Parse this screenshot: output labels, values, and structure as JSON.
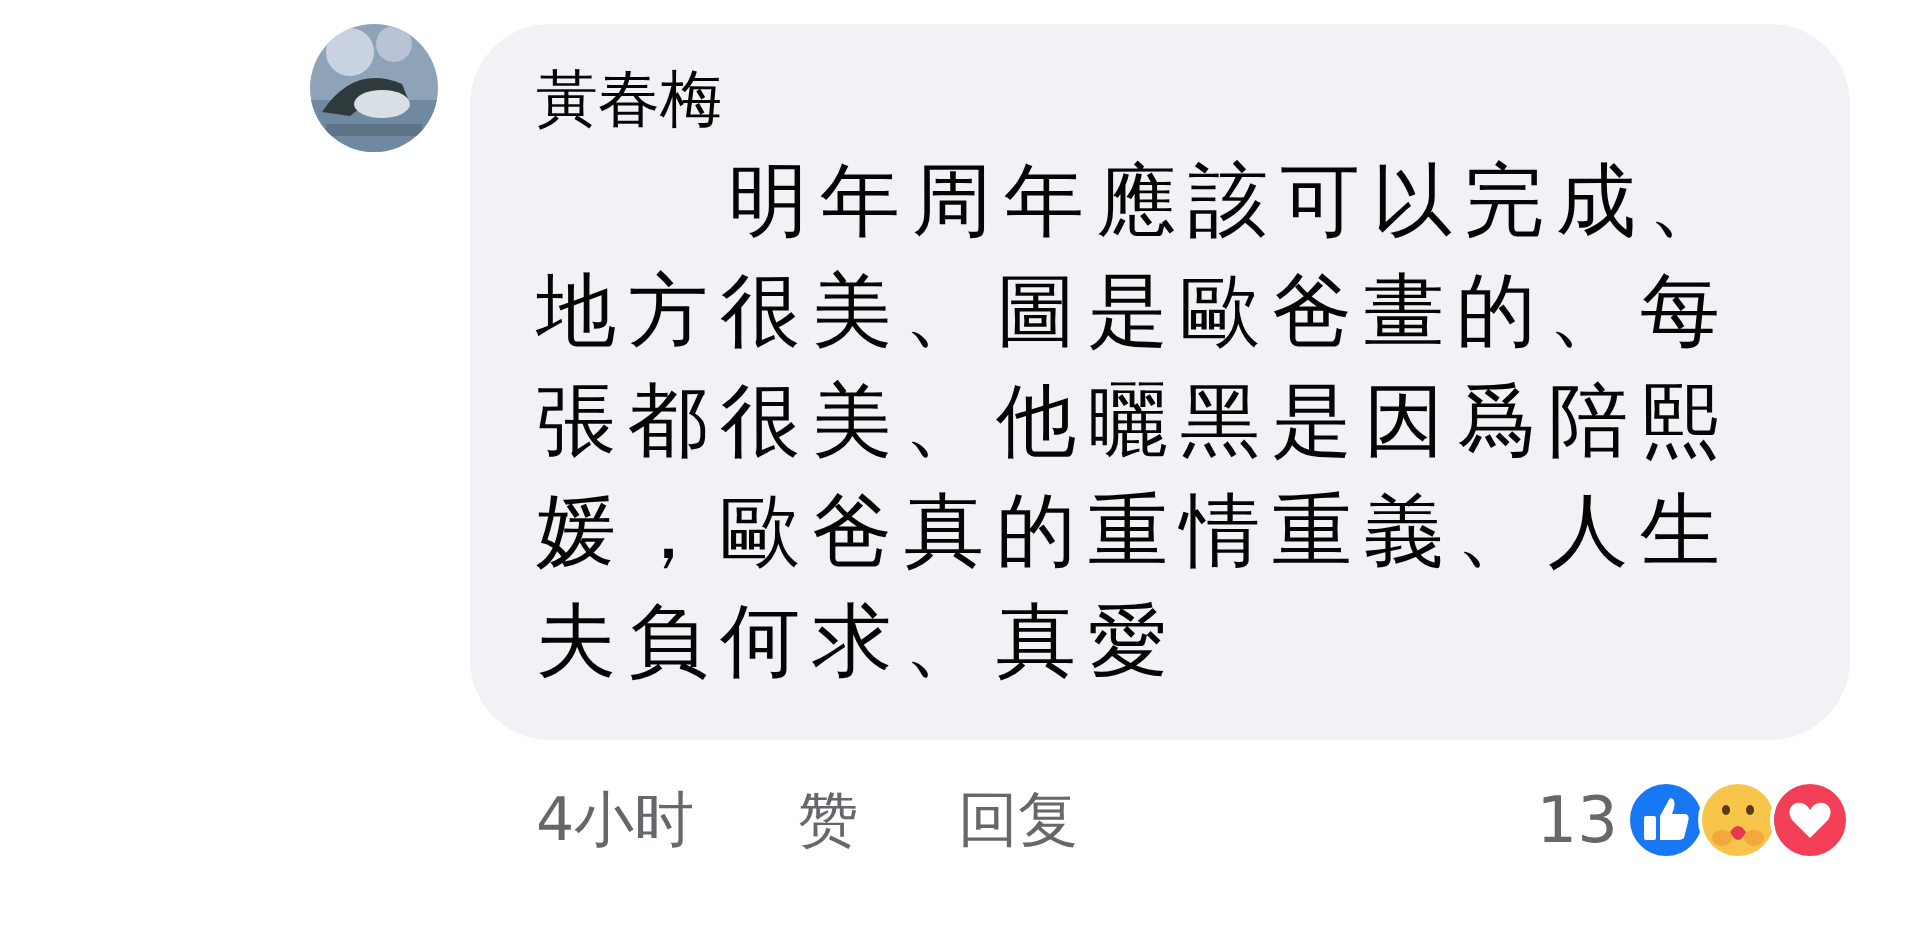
{
  "comment": {
    "author": "黃春梅",
    "text": "明年周年應該可以完成、地方很美、圖是歐爸畫的、每張都很美、他曬黑是因爲陪熙媛，歐爸真的重情重義、人生夫負何求、真愛",
    "time": "4小时",
    "actions": [
      "赞",
      "回复"
    ],
    "reaction_count": "13"
  }
}
